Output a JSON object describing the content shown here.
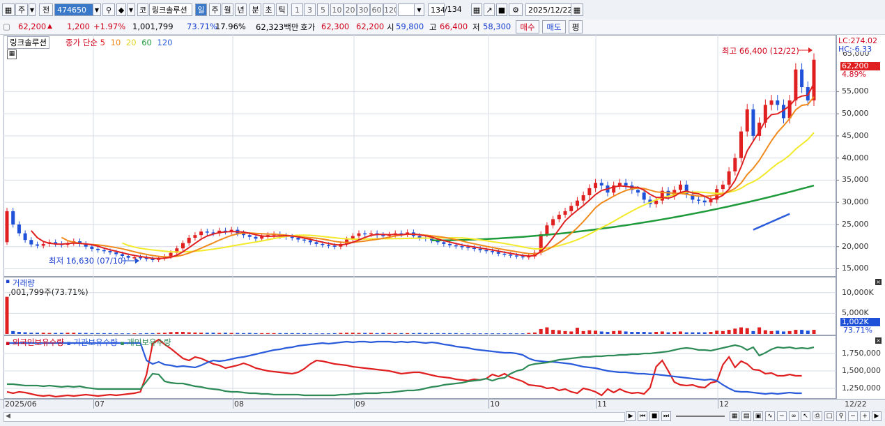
{
  "toolbar": {
    "mode_buttons": [
      "주",
      "전"
    ],
    "code": "474650",
    "search_icon": "search-icon",
    "speaker_icon": "speaker-icon",
    "prefix_label": "코",
    "stock_name": "링크솔루션",
    "periods": [
      "일",
      "주",
      "월",
      "년",
      "분",
      "초",
      "틱"
    ],
    "active_period": "일",
    "minute_steps": [
      "1",
      "3",
      "5",
      "10",
      "20",
      "30",
      "60",
      "120"
    ],
    "counter": "134",
    "counter_total": "/134",
    "date": "2025/12/22"
  },
  "quote": {
    "price": "62,200",
    "change": "1,200",
    "change_pct": "+1.97%",
    "volume": "1,001,799",
    "ratio1": "73.71%",
    "ratio2": "17.96%",
    "amount": "62,323백만",
    "ask_label": "호가",
    "ask": "62,300",
    "bid": "62,200",
    "open_label": "시",
    "open": "59,800",
    "high_label": "고",
    "high": "66,400",
    "low_label": "저",
    "low": "58,300",
    "buy_button": "매수",
    "sell_button": "매도",
    "avg_button": "평"
  },
  "colors": {
    "up": "#e02020",
    "down": "#1e50d8",
    "ma5": "#e02020",
    "ma10": "#f08a1c",
    "ma20": "#f2ea2a",
    "ma60": "#1e9a3a",
    "ma120": "#2a5bdb",
    "foreign": "#e02020",
    "inst": "#2a5bdb",
    "indiv": "#2e8b57"
  },
  "price_legend": {
    "name": "링크솔루션",
    "series_label": "종가 단순",
    "ma_periods": [
      "5",
      "10",
      "20",
      "60",
      "120"
    ]
  },
  "scale": {
    "lc": "LC:274.02",
    "hc": "HC:-6.33",
    "top_partial": "65,000",
    "price_badge": "62,200",
    "pct_label": "4.89%"
  },
  "volume_panel": {
    "title": "거래량",
    "value_label": ",001,799주(73.71%)",
    "badge": "1,002K",
    "pct": "73.71%"
  },
  "holdings_legend": [
    "외국인보유수량",
    "기관보유수량",
    "개인보유수량"
  ],
  "xaxis": {
    "labels": [
      "2025/06",
      "07",
      "08",
      "09",
      "10",
      "11",
      "12"
    ],
    "right_label": "12/22"
  },
  "chart_data": [
    {
      "type": "candlestick",
      "title": "링크솔루션",
      "ylim": [
        13500,
        67500
      ],
      "yticks": [
        15000,
        20000,
        25000,
        30000,
        35000,
        40000,
        45000,
        50000,
        55000
      ],
      "ytick_labels": [
        "15,000",
        "20,000",
        "25,000",
        "30,000",
        "35,000",
        "40,000",
        "45,000",
        "50,000",
        "55,000"
      ],
      "annotations": [
        {
          "text": "최고 66,400 (12/22)",
          "value": 66400
        },
        {
          "text": "최저 16,630 (07/10)",
          "value": 16630
        }
      ],
      "candles_close": [
        28000,
        25000,
        23000,
        21500,
        20500,
        20200,
        20600,
        21000,
        20600,
        20400,
        20800,
        21200,
        20600,
        20000,
        19500,
        19200,
        19000,
        18700,
        18300,
        17900,
        17500,
        17600,
        17500,
        17200,
        17000,
        17400,
        17800,
        18600,
        19600,
        20800,
        22000,
        22600,
        23400,
        23200,
        23000,
        23600,
        23400,
        23800,
        23000,
        22600,
        22200,
        21800,
        22400,
        22600,
        22800,
        22400,
        22200,
        22000,
        21600,
        21400,
        21000,
        20600,
        20400,
        20200,
        20000,
        20600,
        21600,
        22400,
        23000,
        22800,
        23000,
        22600,
        22400,
        22700,
        23000,
        22800,
        23200,
        22400,
        22000,
        21800,
        21400,
        21000,
        20600,
        20300,
        20100,
        19900,
        19700,
        19500,
        19200,
        19000,
        18800,
        18400,
        18200,
        18000,
        17800,
        17600,
        17800,
        18600,
        22800,
        24800,
        26200,
        27200,
        28000,
        29200,
        30400,
        31600,
        33200,
        34400,
        33800,
        32200,
        33800,
        34400,
        33800,
        32800,
        32200,
        30600,
        29600,
        30400,
        32600,
        31400,
        32800,
        34000,
        31800,
        30600,
        30400,
        30000,
        30600,
        33000,
        34000,
        37000,
        40000,
        46000,
        51000,
        45000,
        48000,
        52000,
        53000,
        52000,
        49000,
        53000,
        60000,
        56000,
        53000,
        62200
      ],
      "ma5_start": 8,
      "ma60_start": 70,
      "ma120_start": 129
    },
    {
      "type": "bar",
      "title": "거래량",
      "ylim": [
        0,
        13500000
      ],
      "yticks": [
        5000000,
        10000000
      ],
      "ytick_labels": [
        "5,000K",
        "10,000K"
      ],
      "values_k": [
        9000,
        700,
        500,
        400,
        300,
        300,
        300,
        250,
        250,
        250,
        300,
        300,
        250,
        250,
        200,
        200,
        200,
        200,
        150,
        150,
        150,
        150,
        150,
        200,
        200,
        250,
        300,
        450,
        500,
        500,
        400,
        350,
        300,
        300,
        300,
        250,
        300,
        250,
        250,
        200,
        250,
        200,
        200,
        200,
        200,
        200,
        200,
        200,
        200,
        200,
        150,
        150,
        150,
        150,
        200,
        250,
        300,
        300,
        250,
        250,
        250,
        200,
        250,
        200,
        200,
        200,
        200,
        200,
        250,
        200,
        200,
        200,
        200,
        200,
        200,
        150,
        150,
        150,
        150,
        150,
        150,
        150,
        150,
        150,
        150,
        150,
        250,
        350,
        1200,
        1600,
        1000,
        900,
        700,
        600,
        1500,
        700,
        900,
        800,
        600,
        500,
        700,
        800,
        600,
        500,
        500,
        500,
        400,
        500,
        600,
        400,
        500,
        600,
        400,
        400,
        400,
        400,
        500,
        800,
        700,
        1000,
        1300,
        1600,
        1400,
        700,
        1600,
        900,
        700,
        800,
        600,
        700,
        1000,
        1000,
        800,
        1002
      ]
    },
    {
      "type": "line",
      "title": "보유수량",
      "ylim": [
        1120000,
        1980000
      ],
      "yticks": [
        1250000,
        1500000,
        1750000
      ],
      "ytick_labels": [
        "1,250,000",
        "1,500,000",
        "1,750,000"
      ],
      "series": [
        {
          "name": "외국인보유수량",
          "values": [
            1200000,
            1180000,
            1200000,
            1190000,
            1170000,
            1150000,
            1140000,
            1150000,
            1130000,
            1140000,
            1150000,
            1140000,
            1150000,
            1160000,
            1150000,
            1140000,
            1150000,
            1160000,
            1150000,
            1160000,
            1170000,
            1180000,
            1200000,
            1450000,
            1890000,
            1950000,
            1880000,
            1820000,
            1750000,
            1680000,
            1650000,
            1700000,
            1680000,
            1640000,
            1600000,
            1580000,
            1540000,
            1560000,
            1580000,
            1610000,
            1580000,
            1540000,
            1520000,
            1500000,
            1490000,
            1480000,
            1470000,
            1460000,
            1480000,
            1530000,
            1600000,
            1650000,
            1640000,
            1620000,
            1600000,
            1590000,
            1580000,
            1560000,
            1550000,
            1540000,
            1530000,
            1520000,
            1510000,
            1500000,
            1480000,
            1460000,
            1470000,
            1480000,
            1480000,
            1460000,
            1440000,
            1420000,
            1410000,
            1400000,
            1380000,
            1370000,
            1360000,
            1380000,
            1370000,
            1390000,
            1450000,
            1420000,
            1460000,
            1410000,
            1380000,
            1350000,
            1300000,
            1290000,
            1280000,
            1250000,
            1260000,
            1220000,
            1240000,
            1200000,
            1180000,
            1250000,
            1230000,
            1200000,
            1150000,
            1240000,
            1190000,
            1240000,
            1200000,
            1180000,
            1190000,
            1170000,
            1260000,
            1560000,
            1650000,
            1500000,
            1340000,
            1300000,
            1290000,
            1300000,
            1270000,
            1260000,
            1330000,
            1350000,
            1590000,
            1700000,
            1550000,
            1640000,
            1600000,
            1520000,
            1510000,
            1460000,
            1470000,
            1430000,
            1430000,
            1450000,
            1430000,
            1430000
          ]
        },
        {
          "name": "기관보유수량",
          "values": [
            1900000,
            1900000,
            1900000,
            1900000,
            1900000,
            1900000,
            1900000,
            1900000,
            1900000,
            1900000,
            1900000,
            1900000,
            1900000,
            1900000,
            1900000,
            1900000,
            1900000,
            1900000,
            1900000,
            1900000,
            1900000,
            1900000,
            1900000,
            1650000,
            1600000,
            1630000,
            1590000,
            1580000,
            1560000,
            1570000,
            1560000,
            1550000,
            1580000,
            1620000,
            1650000,
            1640000,
            1650000,
            1670000,
            1690000,
            1700000,
            1720000,
            1740000,
            1760000,
            1780000,
            1800000,
            1810000,
            1830000,
            1840000,
            1860000,
            1870000,
            1880000,
            1890000,
            1900000,
            1890000,
            1900000,
            1910000,
            1920000,
            1910000,
            1920000,
            1920000,
            1910000,
            1920000,
            1920000,
            1920000,
            1910000,
            1920000,
            1910000,
            1920000,
            1910000,
            1900000,
            1910000,
            1900000,
            1880000,
            1870000,
            1850000,
            1840000,
            1830000,
            1810000,
            1800000,
            1790000,
            1780000,
            1770000,
            1760000,
            1760000,
            1750000,
            1730000,
            1680000,
            1650000,
            1640000,
            1630000,
            1630000,
            1620000,
            1610000,
            1600000,
            1580000,
            1560000,
            1550000,
            1540000,
            1520000,
            1500000,
            1490000,
            1480000,
            1480000,
            1470000,
            1460000,
            1460000,
            1450000,
            1450000,
            1440000,
            1430000,
            1420000,
            1410000,
            1400000,
            1390000,
            1380000,
            1370000,
            1380000,
            1360000,
            1300000,
            1250000,
            1210000,
            1200000,
            1200000,
            1190000,
            1180000,
            1170000,
            1180000,
            1170000,
            1180000,
            1190000,
            1180000,
            1180000
          ]
        },
        {
          "name": "개인보유수량",
          "values": [
            1310000,
            1310000,
            1300000,
            1290000,
            1290000,
            1290000,
            1280000,
            1290000,
            1280000,
            1270000,
            1280000,
            1270000,
            1280000,
            1260000,
            1250000,
            1240000,
            1240000,
            1240000,
            1240000,
            1240000,
            1240000,
            1240000,
            1240000,
            1350000,
            1460000,
            1450000,
            1350000,
            1330000,
            1320000,
            1320000,
            1300000,
            1280000,
            1270000,
            1250000,
            1240000,
            1230000,
            1210000,
            1200000,
            1200000,
            1190000,
            1180000,
            1180000,
            1170000,
            1170000,
            1160000,
            1160000,
            1160000,
            1160000,
            1160000,
            1150000,
            1150000,
            1150000,
            1150000,
            1150000,
            1150000,
            1160000,
            1160000,
            1170000,
            1170000,
            1180000,
            1180000,
            1180000,
            1190000,
            1190000,
            1200000,
            1210000,
            1220000,
            1220000,
            1230000,
            1250000,
            1270000,
            1280000,
            1300000,
            1310000,
            1320000,
            1330000,
            1350000,
            1360000,
            1370000,
            1390000,
            1360000,
            1390000,
            1400000,
            1460000,
            1500000,
            1520000,
            1580000,
            1600000,
            1610000,
            1620000,
            1640000,
            1660000,
            1670000,
            1680000,
            1690000,
            1700000,
            1700000,
            1710000,
            1710000,
            1720000,
            1720000,
            1730000,
            1730000,
            1740000,
            1740000,
            1750000,
            1750000,
            1760000,
            1770000,
            1780000,
            1800000,
            1820000,
            1830000,
            1820000,
            1800000,
            1800000,
            1790000,
            1810000,
            1830000,
            1850000,
            1870000,
            1850000,
            1800000,
            1840000,
            1720000,
            1760000,
            1810000,
            1840000,
            1830000,
            1840000,
            1820000,
            1830000,
            1820000,
            1840000
          ]
        }
      ]
    }
  ]
}
